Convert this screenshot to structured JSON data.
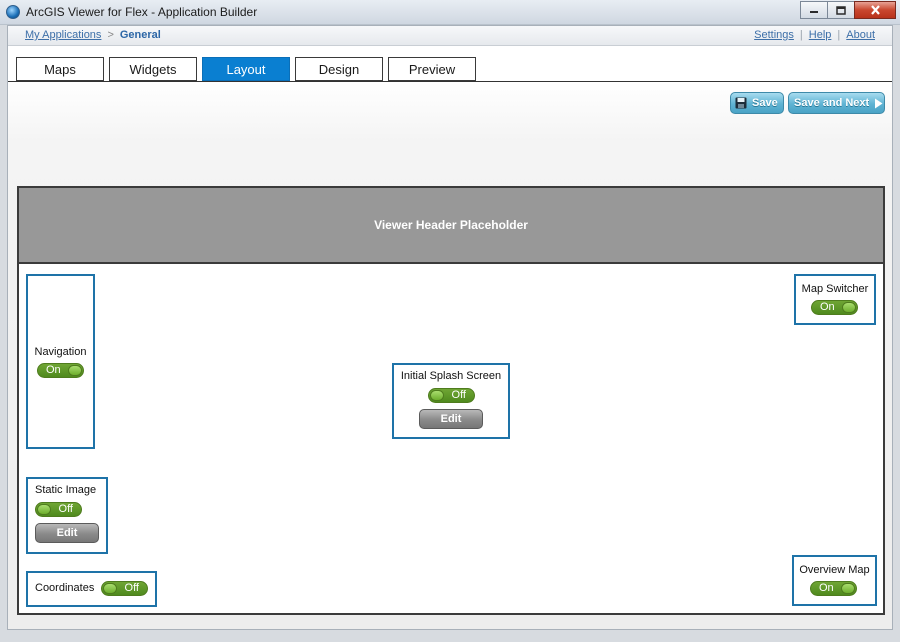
{
  "window": {
    "title": "ArcGIS Viewer for Flex - Application Builder",
    "controls": [
      "minimize",
      "maximize",
      "close"
    ]
  },
  "navbar": {
    "breadcrumb": {
      "link": "My Applications",
      "separator": ">",
      "current": "General"
    },
    "links": [
      "Settings",
      "Help",
      "About"
    ],
    "divider": "|"
  },
  "tabs": [
    {
      "label": "Maps",
      "active": false
    },
    {
      "label": "Widgets",
      "active": false
    },
    {
      "label": "Layout",
      "active": true
    },
    {
      "label": "Design",
      "active": false
    },
    {
      "label": "Preview",
      "active": false
    }
  ],
  "toolbar": {
    "save_label": "Save",
    "save_next_label": "Save and Next"
  },
  "layout": {
    "header_placeholder": "Viewer Header Placeholder",
    "navigation": {
      "label": "Navigation",
      "toggle": "On"
    },
    "map_switcher": {
      "label": "Map Switcher",
      "toggle": "On"
    },
    "splash": {
      "label": "Initial Splash Screen",
      "toggle": "Off",
      "edit": "Edit"
    },
    "static_image": {
      "label": "Static Image",
      "toggle": "Off",
      "edit": "Edit"
    },
    "coordinates": {
      "label": "Coordinates",
      "toggle": "Off"
    },
    "overview_map": {
      "label": "Overview Map",
      "toggle": "On"
    }
  },
  "colors": {
    "accent": "#0a7fd1",
    "slot_border": "#1e73a8",
    "toggle_green": "#5a9626",
    "save_blue": "#5fb3d3",
    "header_gray": "#989898"
  },
  "icons": [
    "globe-app-icon",
    "minimize-icon",
    "maximize-icon",
    "close-icon",
    "floppy-disk-icon",
    "arrow-right-icon"
  ]
}
